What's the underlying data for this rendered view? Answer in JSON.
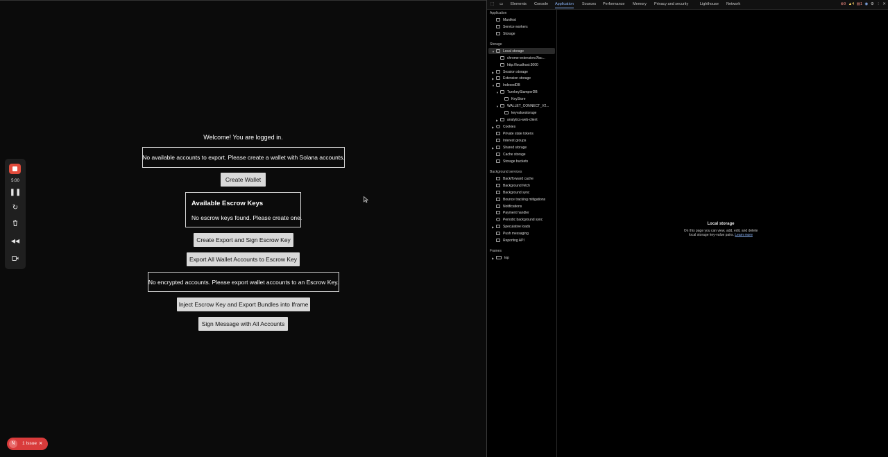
{
  "page": {
    "welcome": "Welcome! You are logged in.",
    "no_accounts_msg": "No available accounts to export. Please create a wallet with Solana accounts.",
    "create_wallet": "Create Wallet",
    "escrow_title": "Available Escrow Keys",
    "escrow_msg": "No escrow keys found. Please create one.",
    "create_export_sign": "Create Export and Sign Escrow Key",
    "export_all": "Export All Wallet Accounts to Escrow Key",
    "no_encrypted_msg": "No encrypted accounts. Please export wallet accounts to an Escrow Key.",
    "inject": "Inject Escrow Key and Export Bundles into Iframe",
    "sign_message": "Sign Message with All Accounts"
  },
  "recorder": {
    "time": "5:00",
    "accent": "#e24c3c"
  },
  "issue_badge": {
    "letter": "N",
    "label": "1 Issue",
    "close": "×"
  },
  "devtools": {
    "tabs": [
      "Elements",
      "Console",
      "Application",
      "Sources",
      "Performance",
      "Memory",
      "Privacy and security",
      "Lighthouse",
      "Network"
    ],
    "active_tab": "Application",
    "counters": {
      "errors": "9",
      "warnings": "4",
      "info": "1"
    },
    "tree": {
      "application_header": "Application",
      "application_items": [
        "Manifest",
        "Service workers",
        "Storage"
      ],
      "storage_header": "Storage",
      "local_storage": "Local storage",
      "local_children": [
        "chrome-extension://fac...",
        "http://localhost:3000"
      ],
      "session_storage": "Session storage",
      "extension_storage": "Extension storage",
      "indexeddb": "IndexedDB",
      "turnkey_db": "TurnkeyStamperDB",
      "keystore": "KeyStore",
      "wallet_connect": "WALLET_CONNECT_V2...",
      "keyvalue": "keyvaluestorage",
      "analytics": "analytics-web-client",
      "storage_rest": [
        "Cookies",
        "Private state tokens",
        "Interest groups",
        "Shared storage",
        "Cache storage",
        "Storage buckets"
      ],
      "background_header": "Background services",
      "background_items": [
        "Back/forward cache",
        "Background fetch",
        "Background sync",
        "Bounce tracking mitigations",
        "Notifications",
        "Payment handler",
        "Periodic background sync",
        "Speculative loads",
        "Push messaging",
        "Reporting API"
      ],
      "frames_header": "Frames",
      "frames_top": "top"
    },
    "empty": {
      "title": "Local storage",
      "desc": "On this page you can view, add, edit, and delete local storage key-value pairs.",
      "link": "Learn more"
    }
  }
}
